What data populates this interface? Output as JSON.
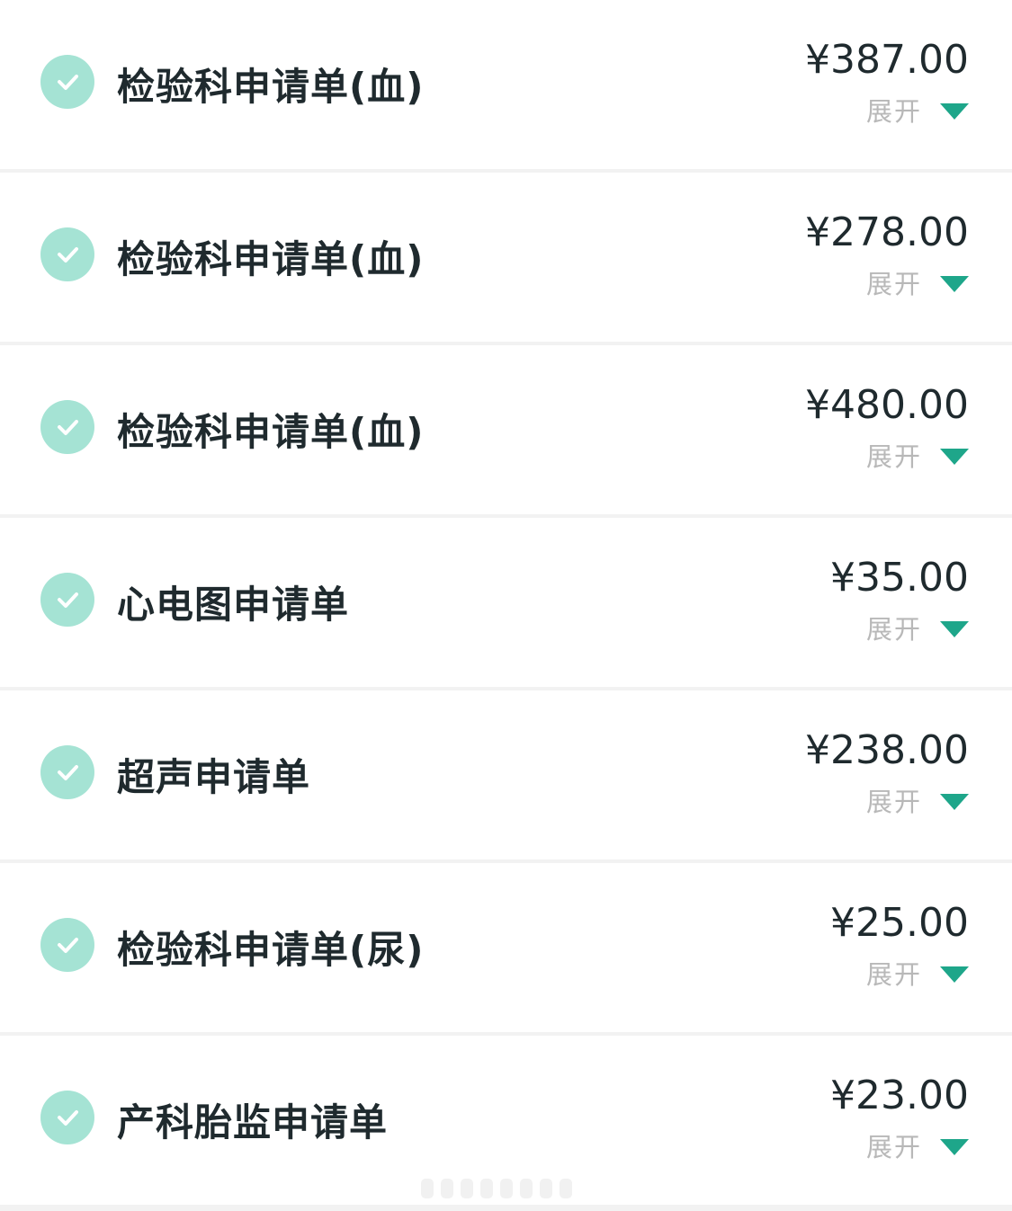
{
  "colors": {
    "check_circle": "#a5e3d4",
    "accent": "#1ea68a",
    "title_text": "#1f2a2e",
    "muted_text": "#b8b8b8",
    "divider": "#eeeeee"
  },
  "items": [
    {
      "name": "检验科申请单(血)",
      "price": "¥387.00",
      "expand_label": "展开",
      "checked": true
    },
    {
      "name": "检验科申请单(血)",
      "price": "¥278.00",
      "expand_label": "展开",
      "checked": true
    },
    {
      "name": "检验科申请单(血)",
      "price": "¥480.00",
      "expand_label": "展开",
      "checked": true
    },
    {
      "name": "心电图申请单",
      "price": "¥35.00",
      "expand_label": "展开",
      "checked": true
    },
    {
      "name": "超声申请单",
      "price": "¥238.00",
      "expand_label": "展开",
      "checked": true
    },
    {
      "name": "检验科申请单(尿)",
      "price": "¥25.00",
      "expand_label": "展开",
      "checked": true
    },
    {
      "name": "产科胎监申请单",
      "price": "¥23.00",
      "expand_label": "展开",
      "checked": true
    }
  ]
}
